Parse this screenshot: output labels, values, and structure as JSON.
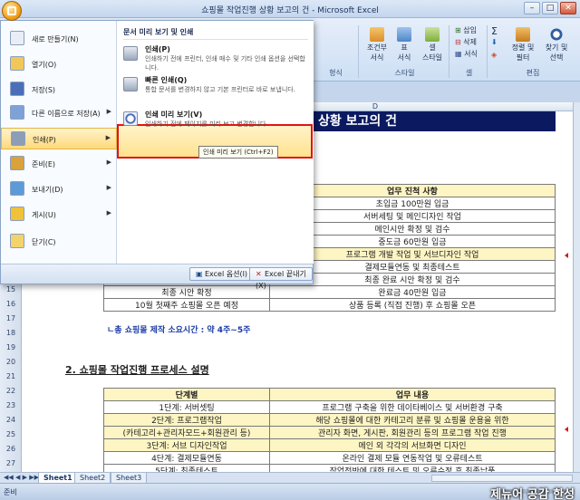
{
  "window": {
    "title": "쇼핑몰 작업진행 상황 보고의 건 - Microsoft Excel",
    "minimize": "–",
    "maximize": "□",
    "close": "✕"
  },
  "ribbon": {
    "groups": [
      {
        "label": "형식"
      },
      {
        "label": "스타일"
      },
      {
        "label": "셀"
      },
      {
        "label": "편집"
      }
    ],
    "buttons": {
      "conditional": "조건부\n서식",
      "table_format": "표\n서식",
      "cell_style": "셀\n스타일",
      "insert": "삽입",
      "delete": "삭제",
      "format": "서식",
      "sort_filter": "정렬 및\n필터",
      "find_select": "찾기 및\n선택"
    }
  },
  "column_header": "D",
  "banner": "상황 보고의 건",
  "row_numbers": [
    "3",
    "4",
    "5",
    "6",
    "7",
    "8",
    "9",
    "10",
    "11",
    "12",
    "13",
    "14",
    "15",
    "16",
    "17",
    "18",
    "19",
    "20",
    "21",
    "22",
    "23",
    "24",
    "25",
    "26",
    "27"
  ],
  "table1": {
    "header": "업무 진척 사항",
    "rows": [
      {
        "left": "",
        "right": "초입금 100만원 입금",
        "hl": false
      },
      {
        "left": "",
        "right": "서버세팅 및 메인디자인 작업",
        "hl": false
      },
      {
        "left": "",
        "right": "메인시안 확정 및 검수",
        "hl": false
      },
      {
        "left": "",
        "right": "중도금 60만원 입금",
        "hl": false
      },
      {
        "left": "",
        "right": "프로그램 개발 작업 및 서브디자인 작업",
        "hl": true
      },
      {
        "left": "",
        "right": "결제모듈연동 및 최종테스트",
        "hl": false
      },
      {
        "left": "",
        "right": "최종 완료 시안 확정 및 검수",
        "hl": false
      },
      {
        "left": "최종 시안 확정",
        "right": "완료금 40만원 입금",
        "hl": false
      },
      {
        "left": "10월 첫째주 쇼핑몰 오픈 예정",
        "right": "상품 등록 (직접 진행) 후 쇼핑몰 오픈",
        "hl": false
      }
    ]
  },
  "duration_text": "ㄴ총 쇼핑몰 제작 소요시간 : 약 4주~5주",
  "section_title": "2. 쇼핑몰 작업진행 프로세스 설명",
  "table2": {
    "headers": [
      "단계별",
      "업무 내용"
    ],
    "rows": [
      {
        "left": "1단계: 서버셋팅",
        "right": "프로그램 구축을 위한 데이타베이스 및 서버환경 구축",
        "hl": false
      },
      {
        "left": "2단계: 프로그램작업",
        "right": "해당 쇼핑몰에 대한 카테고리 분류 및 쇼핑몰 운용을 위한",
        "hl": true
      },
      {
        "left": "(카테고리+관리자모드+회원관리 등)",
        "right": "관리자 화면, 게시판, 회원관리 등의 프로그램 작업 진행",
        "hl": true
      },
      {
        "left": "3단계: 서브 디자인작업",
        "right": "메인 외 각각의 서브화면 디자인",
        "hl": true
      },
      {
        "left": "4단계: 결제모듈연동",
        "right": "온라인 결제 모듈 연동작업 및 오류테스트",
        "hl": false
      },
      {
        "left": "5단계: 최종테스트",
        "right": "작업전반에 대한 테스트 및 오류수정 후 최종납품",
        "hl": false
      }
    ]
  },
  "sheet_tabs": [
    "Sheet1",
    "Sheet2",
    "Sheet3"
  ],
  "status": {
    "ready": "준비"
  },
  "watermark": "제뉴어 공감 한성",
  "office_menu": {
    "items": [
      {
        "label": "새로 만들기(N)",
        "icon": "new-doc-icon",
        "arrow": false
      },
      {
        "label": "열기(O)",
        "icon": "open-folder-icon",
        "arrow": false
      },
      {
        "label": "저장(S)",
        "icon": "save-icon",
        "arrow": false
      },
      {
        "label": "다른 이름으로 저장(A)",
        "icon": "save-as-icon",
        "arrow": true
      },
      {
        "label": "인쇄(P)",
        "icon": "print-icon",
        "arrow": true
      },
      {
        "label": "준비(E)",
        "icon": "prepare-icon",
        "arrow": true
      },
      {
        "label": "보내기(D)",
        "icon": "send-icon",
        "arrow": true
      },
      {
        "label": "게시(U)",
        "icon": "publish-icon",
        "arrow": true
      },
      {
        "label": "닫기(C)",
        "icon": "close-doc-icon",
        "arrow": false
      }
    ],
    "submenu_title": "문서 미리 보기 및 인쇄",
    "sub_items": [
      {
        "title": "인쇄(P)",
        "desc": "인쇄하기 전에 프린터, 인쇄 매수 및 기타 인쇄 옵션을 선택합니다."
      },
      {
        "title": "빠른 인쇄(Q)",
        "desc": "통합 문서를 변경하지 않고 기본 프린터로 바로 보냅니다."
      },
      {
        "title": "인쇄 미리 보기(V)",
        "desc": "인쇄하기 전에 페이지를 미리 보고 변경합니다."
      }
    ],
    "tooltip": "인쇄 미리 보기 (Ctrl+F2)",
    "options_button": "Excel 옵션(I)",
    "exit_button": "Excel 끝내기(X)"
  }
}
